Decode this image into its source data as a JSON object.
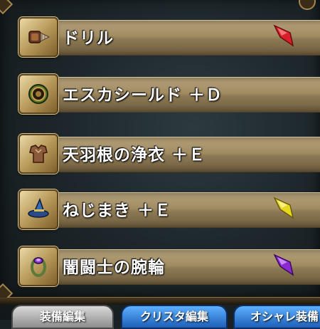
{
  "equipment": [
    {
      "name": "ドリル",
      "icon": "drill-icon",
      "gem_color": "#d8202a",
      "icon_color": "#7a4a2a"
    },
    {
      "name": "エスカシールド ＋Ｄ",
      "icon": "shield-icon",
      "gem_color": null,
      "icon_color": "#4a6a2a"
    },
    {
      "name": "天羽根の浄衣 ＋Ｅ",
      "icon": "robe-icon",
      "gem_color": null,
      "icon_color": "#7a5a3a"
    },
    {
      "name": "ねじまき ＋Ｅ",
      "icon": "wizard-hat-icon",
      "gem_color": "#e6d820",
      "icon_color": "#3a6ab0"
    },
    {
      "name": "闇闘士の腕輪",
      "icon": "bracelet-icon",
      "gem_color": "#8a2ad0",
      "icon_color": "#6a3a8a"
    }
  ],
  "tabs": [
    {
      "label": "装備編集",
      "style": "gray"
    },
    {
      "label": "クリスタ編集",
      "style": "blue"
    },
    {
      "label": "オシャレ装備",
      "style": "blue"
    }
  ]
}
